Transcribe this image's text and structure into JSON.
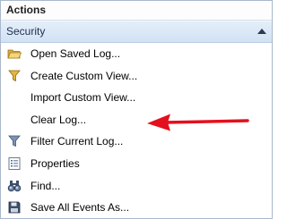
{
  "panel": {
    "title": "Actions"
  },
  "section": {
    "label": "Security"
  },
  "items": [
    {
      "label": "Open Saved Log...",
      "icon": "folder-open-icon"
    },
    {
      "label": "Create Custom View...",
      "icon": "filter-funnel-icon"
    },
    {
      "label": "Import Custom View...",
      "icon": ""
    },
    {
      "label": "Clear Log...",
      "icon": ""
    },
    {
      "label": "Filter Current Log...",
      "icon": "filter-funnel-icon"
    },
    {
      "label": "Properties",
      "icon": "properties-icon"
    },
    {
      "label": "Find...",
      "icon": "binoculars-icon"
    },
    {
      "label": "Save All Events As...",
      "icon": "floppy-disk-icon"
    }
  ],
  "colors": {
    "annotation_arrow": "#e3101e",
    "section_bg": "#d9e6f6"
  }
}
